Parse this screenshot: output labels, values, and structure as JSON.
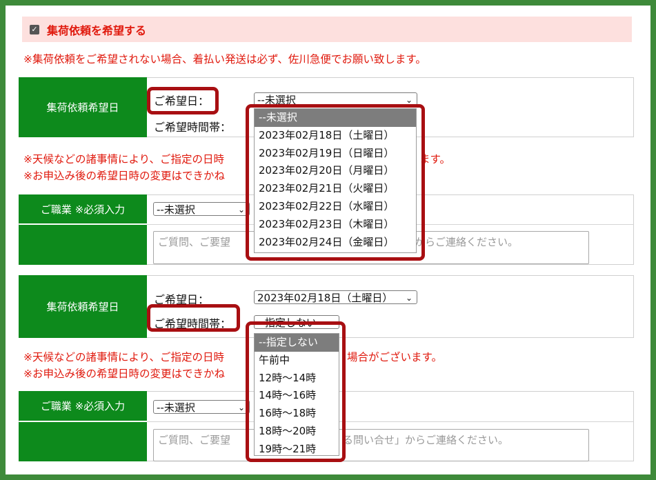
{
  "header": {
    "checkbox_label": "集荷依頼を希望する",
    "notice": "※集荷依頼をご希望されない場合、着払い発送は必ず、佐川急便でお願い致します。"
  },
  "section1": {
    "title": "集荷依頼希望日",
    "date_label": "ご希望日：",
    "time_label": "ご希望時間帯：",
    "date_value": "--未選択",
    "date_options": [
      "--未選択",
      "2023年02月18日（土曜日）",
      "2023年02月19日（日曜日）",
      "2023年02月20日（月曜日）",
      "2023年02月21日（火曜日）",
      "2023年02月22日（水曜日）",
      "2023年02月23日（木曜日）",
      "2023年02月24日（金曜日）"
    ],
    "note1_left": "※天候などの諸事情により、ご指定の日時",
    "note1_right": "ます。",
    "note2_left": "※お申込み後の希望日時の変更はできかね"
  },
  "occupation1": {
    "label": "ご職業 ※必須入力",
    "select_value": "--未選択",
    "textarea_left": "ご質問、ご要望",
    "textarea_right": "からご連絡ください。"
  },
  "section2": {
    "title": "集荷依頼希望日",
    "date_label": "ご希望日：",
    "time_label": "ご希望時間帯：",
    "date_value": "2023年02月18日（土曜日）",
    "time_value": "--指定しない",
    "time_options": [
      "--指定しない",
      "午前中",
      "12時～14時",
      "14時～16時",
      "16時～18時",
      "18時～20時",
      "19時～21時"
    ],
    "note1_left": "※天候などの諸事情により、ご指定の日時",
    "note1_right": "場合がございます。",
    "note2_left": "※お申込み後の希望日時の変更はできかね"
  },
  "occupation2": {
    "label": "ご職業 ※必須入力",
    "select_value": "--未選択",
    "textarea_left": "ご質問、ご要望",
    "textarea_right": "る問い合せ」からご連絡ください。"
  },
  "colors": {
    "frame": "#3e8a3a",
    "header_green": "#0d8a1c",
    "notice_red": "#e0190d",
    "highlight": "#a80f12",
    "pink": "#fde0de"
  }
}
